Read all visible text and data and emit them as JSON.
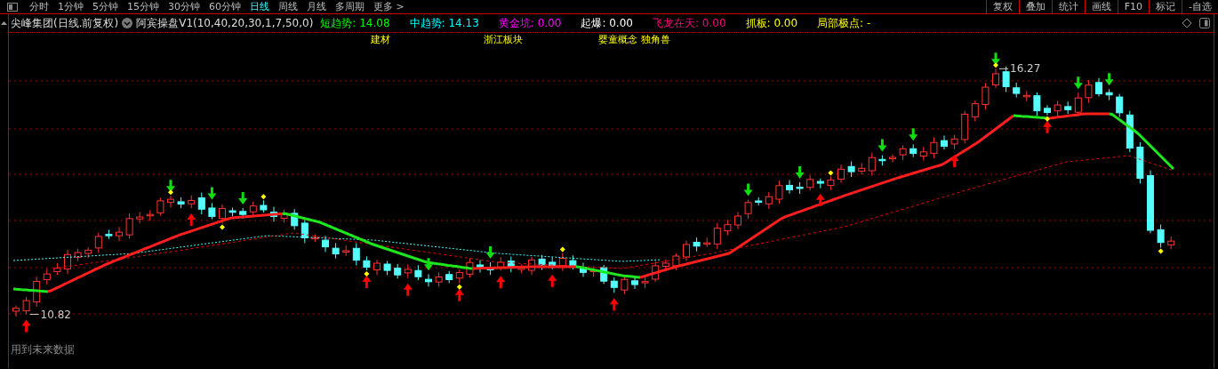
{
  "menu_bar": {
    "left_items": [
      {
        "label": "分时",
        "selected": false
      },
      {
        "label": "1分钟",
        "selected": false
      },
      {
        "label": "5分钟",
        "selected": false
      },
      {
        "label": "15分钟",
        "selected": false
      },
      {
        "label": "30分钟",
        "selected": false
      },
      {
        "label": "60分钟",
        "selected": false
      },
      {
        "label": "日线",
        "selected": true
      },
      {
        "label": "周线",
        "selected": false
      },
      {
        "label": "月线",
        "selected": false
      },
      {
        "label": "多周期",
        "selected": false
      },
      {
        "label": "更多 >",
        "selected": false
      }
    ],
    "right_items": [
      "复权",
      "叠加",
      "统计",
      "画线",
      "F10",
      "标记",
      "-自选"
    ]
  },
  "legend": {
    "title": "尖峰集团(日线.前复权)",
    "indicator": "阿宾操盘V1(10,40,20,30,1,7,50,0)",
    "values": [
      {
        "label": "短趋势:",
        "value": "14.08",
        "color": "#00ff00"
      },
      {
        "label": "中趋势:",
        "value": "14.13",
        "color": "#00ffff"
      },
      {
        "label": "黄金坑:",
        "value": "0.00",
        "color": "#ff00ff"
      },
      {
        "label": "起爆:",
        "value": "0.00",
        "color": "#ffffff"
      },
      {
        "label": "飞龙在天:",
        "value": "0.00",
        "color": "#ff0080"
      },
      {
        "label": "抓板:",
        "value": "0.00",
        "color": "#ffff00"
      },
      {
        "label": "局部极点:",
        "value": "-",
        "color": "#ffff00"
      }
    ]
  },
  "concepts": [
    "建材",
    "浙江板块",
    "婴童概念",
    "独角兽"
  ],
  "price_labels": {
    "high": "16.27",
    "low": "10.82"
  },
  "note": "用到未来数据"
}
